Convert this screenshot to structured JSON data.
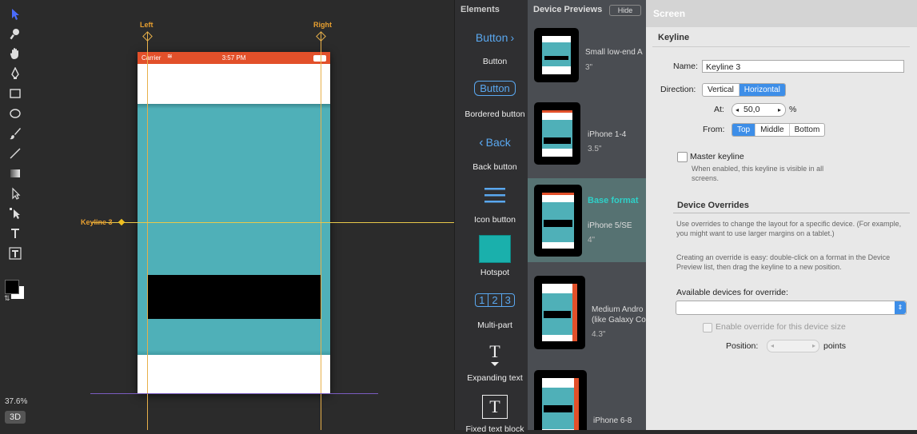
{
  "toolbar": {
    "tools": [
      "pointer-icon",
      "magnifier-icon",
      "hand-icon",
      "pen-icon",
      "rectangle-icon",
      "ellipse-icon",
      "brush-icon",
      "line-icon",
      "gradient-icon",
      "direct-select-icon",
      "path-select-icon",
      "text-icon",
      "text-box-icon"
    ],
    "zoom": "37.6%",
    "mode_3d": "3D"
  },
  "canvas": {
    "guide_left_label": "Left",
    "guide_right_label": "Right",
    "keyline_label": "Keyline 3",
    "status_carrier": "Carrier",
    "status_time": "3:57 PM",
    "colors": {
      "status": "#e2502a",
      "teal": "#4fb0b8",
      "guide": "#e8b04a"
    }
  },
  "elements": {
    "title": "Elements",
    "items": [
      {
        "preview": "Button",
        "label": "Button"
      },
      {
        "preview": "Button",
        "label": "Bordered button"
      },
      {
        "preview": "Back",
        "label": "Back button"
      },
      {
        "preview": "",
        "label": "Icon button"
      },
      {
        "preview": "",
        "label": "Hotspot"
      },
      {
        "preview_parts": [
          "1",
          "2",
          "3"
        ],
        "label": "Multi-part"
      },
      {
        "preview": "T",
        "label": "Expanding text"
      },
      {
        "preview": "T",
        "label": "Fixed text block"
      }
    ]
  },
  "devices": {
    "title": "Device Previews",
    "hide_label": "Hide",
    "items": [
      {
        "name": "Small low-end A",
        "size": "3\""
      },
      {
        "name": "iPhone 1-4",
        "size": "3.5\""
      },
      {
        "name": "Base format",
        "sub": "iPhone 5/SE",
        "size": "4\""
      },
      {
        "name": "Medium Andro",
        "sub": "(like Galaxy Co",
        "size": "4.3\""
      },
      {
        "name": "iPhone 6-8",
        "size": ""
      }
    ]
  },
  "inspector": {
    "header": "Screen",
    "keyline_section": "Keyline",
    "name_label": "Name:",
    "name_value": "Keyline 3",
    "direction_label": "Direction:",
    "direction_options": [
      "Vertical",
      "Horizontal"
    ],
    "direction_selected": "Horizontal",
    "at_label": "At:",
    "at_value": "50,0",
    "at_unit": "%",
    "from_label": "From:",
    "from_options": [
      "Top",
      "Middle",
      "Bottom"
    ],
    "from_selected": "Top",
    "master_label": "Master keyline",
    "master_hint": "When enabled, this keyline is visible in all screens.",
    "overrides_section": "Device Overrides",
    "overrides_hint1": "Use overrides to change the layout for a specific device. (For example, you might want to use larger margins on a tablet.)",
    "overrides_hint2": "Creating an override is easy: double-click on a format in the Device Preview list, then drag the keyline to a new position.",
    "available_label": "Available devices for override:",
    "enable_label": "Enable override for this device size",
    "position_label": "Position:",
    "position_unit": "points"
  }
}
